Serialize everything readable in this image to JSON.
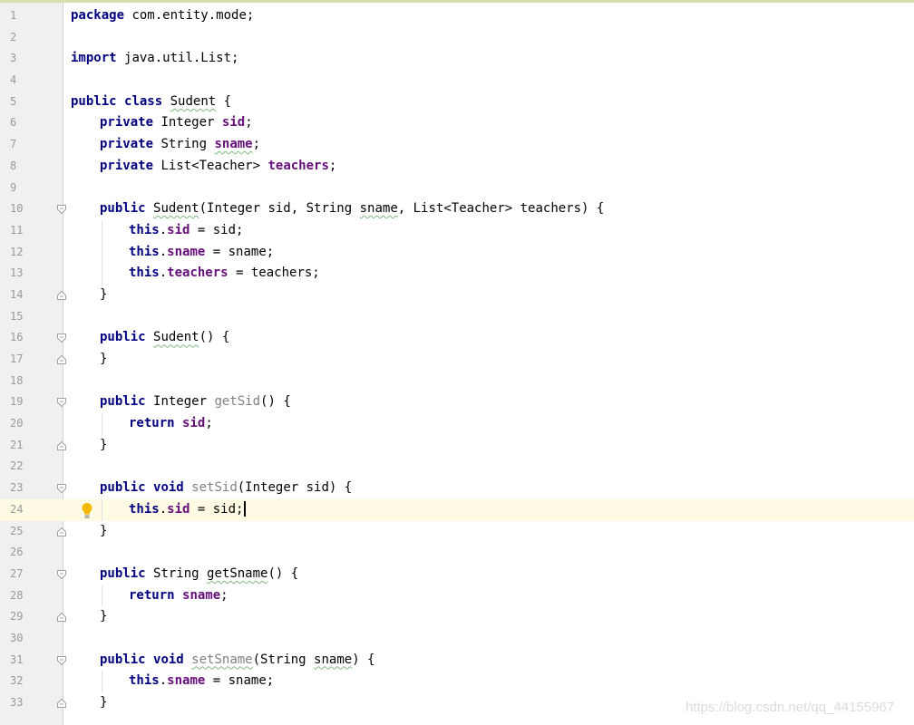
{
  "editor": {
    "lines": [
      {
        "n": "1",
        "indent": 0,
        "t": [
          [
            "kw",
            "package"
          ],
          [
            "",
            "com.entity.mode;"
          ]
        ]
      },
      {
        "n": "2",
        "indent": 0,
        "t": []
      },
      {
        "n": "3",
        "indent": 0,
        "t": [
          [
            "kw",
            "import"
          ],
          [
            "",
            "java.util.List;"
          ]
        ]
      },
      {
        "n": "4",
        "indent": 0,
        "t": []
      },
      {
        "n": "5",
        "indent": 0,
        "t": [
          [
            "kw",
            "public"
          ],
          [
            "kw",
            "class"
          ],
          [
            "wavy",
            "Sudent"
          ],
          [
            "",
            " {"
          ]
        ]
      },
      {
        "n": "6",
        "indent": 1,
        "t": [
          [
            "kw",
            "private"
          ],
          [
            "",
            "Integer "
          ],
          [
            "fld",
            "sid"
          ],
          [
            "",
            ";"
          ]
        ]
      },
      {
        "n": "7",
        "indent": 1,
        "t": [
          [
            "kw",
            "private"
          ],
          [
            "",
            "String "
          ],
          [
            "fld wavy",
            "sname"
          ],
          [
            "",
            ";"
          ]
        ]
      },
      {
        "n": "8",
        "indent": 1,
        "t": [
          [
            "kw",
            "private"
          ],
          [
            "",
            "List<Teacher> "
          ],
          [
            "fld",
            "teachers"
          ],
          [
            "",
            ";"
          ]
        ]
      },
      {
        "n": "9",
        "indent": 0,
        "t": []
      },
      {
        "n": "10",
        "indent": 1,
        "fold": "open",
        "t": [
          [
            "kw",
            "public"
          ],
          [
            "wavy",
            "Sudent"
          ],
          [
            "",
            "(Integer sid, String "
          ],
          [
            "wavy",
            "sname"
          ],
          [
            "",
            ", List<Teacher> teachers) {"
          ]
        ]
      },
      {
        "n": "11",
        "indent": 2,
        "t": [
          [
            "kw",
            "this"
          ],
          [
            "",
            "."
          ],
          [
            "fld",
            "sid"
          ],
          [
            "",
            " = sid;"
          ]
        ]
      },
      {
        "n": "12",
        "indent": 2,
        "t": [
          [
            "kw",
            "this"
          ],
          [
            "",
            "."
          ],
          [
            "fld",
            "sname"
          ],
          [
            "",
            " = sname;"
          ]
        ]
      },
      {
        "n": "13",
        "indent": 2,
        "t": [
          [
            "kw",
            "this"
          ],
          [
            "",
            "."
          ],
          [
            "fld",
            "teachers"
          ],
          [
            "",
            " = teachers;"
          ]
        ]
      },
      {
        "n": "14",
        "indent": 1,
        "fold": "close",
        "t": [
          [
            "",
            "}"
          ]
        ]
      },
      {
        "n": "15",
        "indent": 0,
        "t": []
      },
      {
        "n": "16",
        "indent": 1,
        "fold": "open",
        "t": [
          [
            "kw",
            "public"
          ],
          [
            "wavy",
            "Sudent"
          ],
          [
            "",
            "() {"
          ]
        ]
      },
      {
        "n": "17",
        "indent": 1,
        "fold": "close",
        "t": [
          [
            "",
            "}"
          ]
        ]
      },
      {
        "n": "18",
        "indent": 0,
        "t": []
      },
      {
        "n": "19",
        "indent": 1,
        "fold": "open",
        "t": [
          [
            "kw",
            "public"
          ],
          [
            "",
            "Integer "
          ],
          [
            "unused",
            "getSid"
          ],
          [
            "",
            "() {"
          ]
        ]
      },
      {
        "n": "20",
        "indent": 2,
        "t": [
          [
            "kw",
            "return"
          ],
          [
            "fld",
            "sid"
          ],
          [
            "",
            ";"
          ]
        ]
      },
      {
        "n": "21",
        "indent": 1,
        "fold": "close",
        "t": [
          [
            "",
            "}"
          ]
        ]
      },
      {
        "n": "22",
        "indent": 0,
        "t": []
      },
      {
        "n": "23",
        "indent": 1,
        "fold": "open",
        "t": [
          [
            "kw",
            "public"
          ],
          [
            "kw",
            "void"
          ],
          [
            "unused",
            "setSid"
          ],
          [
            "",
            "(Integer sid) {"
          ]
        ]
      },
      {
        "n": "24",
        "indent": 2,
        "current": true,
        "bulb": true,
        "t": [
          [
            "kw",
            "this"
          ],
          [
            "",
            "."
          ],
          [
            "fld",
            "sid"
          ],
          [
            "",
            " = sid;"
          ],
          [
            "caret",
            ""
          ]
        ]
      },
      {
        "n": "25",
        "indent": 1,
        "fold": "close",
        "t": [
          [
            "",
            "}"
          ]
        ]
      },
      {
        "n": "26",
        "indent": 0,
        "t": []
      },
      {
        "n": "27",
        "indent": 1,
        "fold": "open",
        "t": [
          [
            "kw",
            "public"
          ],
          [
            "",
            "String "
          ],
          [
            "wavy",
            "getSname"
          ],
          [
            "",
            "() {"
          ]
        ]
      },
      {
        "n": "28",
        "indent": 2,
        "t": [
          [
            "kw",
            "return"
          ],
          [
            "fld",
            "sname"
          ],
          [
            "",
            ";"
          ]
        ]
      },
      {
        "n": "29",
        "indent": 1,
        "fold": "close",
        "t": [
          [
            "",
            "}"
          ]
        ]
      },
      {
        "n": "30",
        "indent": 0,
        "t": []
      },
      {
        "n": "31",
        "indent": 1,
        "fold": "open",
        "t": [
          [
            "kw",
            "public"
          ],
          [
            "kw",
            "void"
          ],
          [
            "unused wavy",
            "setSname"
          ],
          [
            "",
            "(String "
          ],
          [
            "wavy",
            "sname"
          ],
          [
            "",
            ") {"
          ]
        ]
      },
      {
        "n": "32",
        "indent": 2,
        "t": [
          [
            "kw",
            "this"
          ],
          [
            "",
            "."
          ],
          [
            "fld",
            "sname"
          ],
          [
            "",
            " = sname;"
          ]
        ]
      },
      {
        "n": "33",
        "indent": 1,
        "fold": "close",
        "t": [
          [
            "",
            "}"
          ]
        ]
      }
    ]
  },
  "watermark": "https://blog.csdn.net/qq_44155967",
  "colors": {
    "keyword": "#000080",
    "field": "#660e7a",
    "unused": "#808080",
    "current_line": "#fffae3",
    "gutter": "#f0f0f0"
  }
}
